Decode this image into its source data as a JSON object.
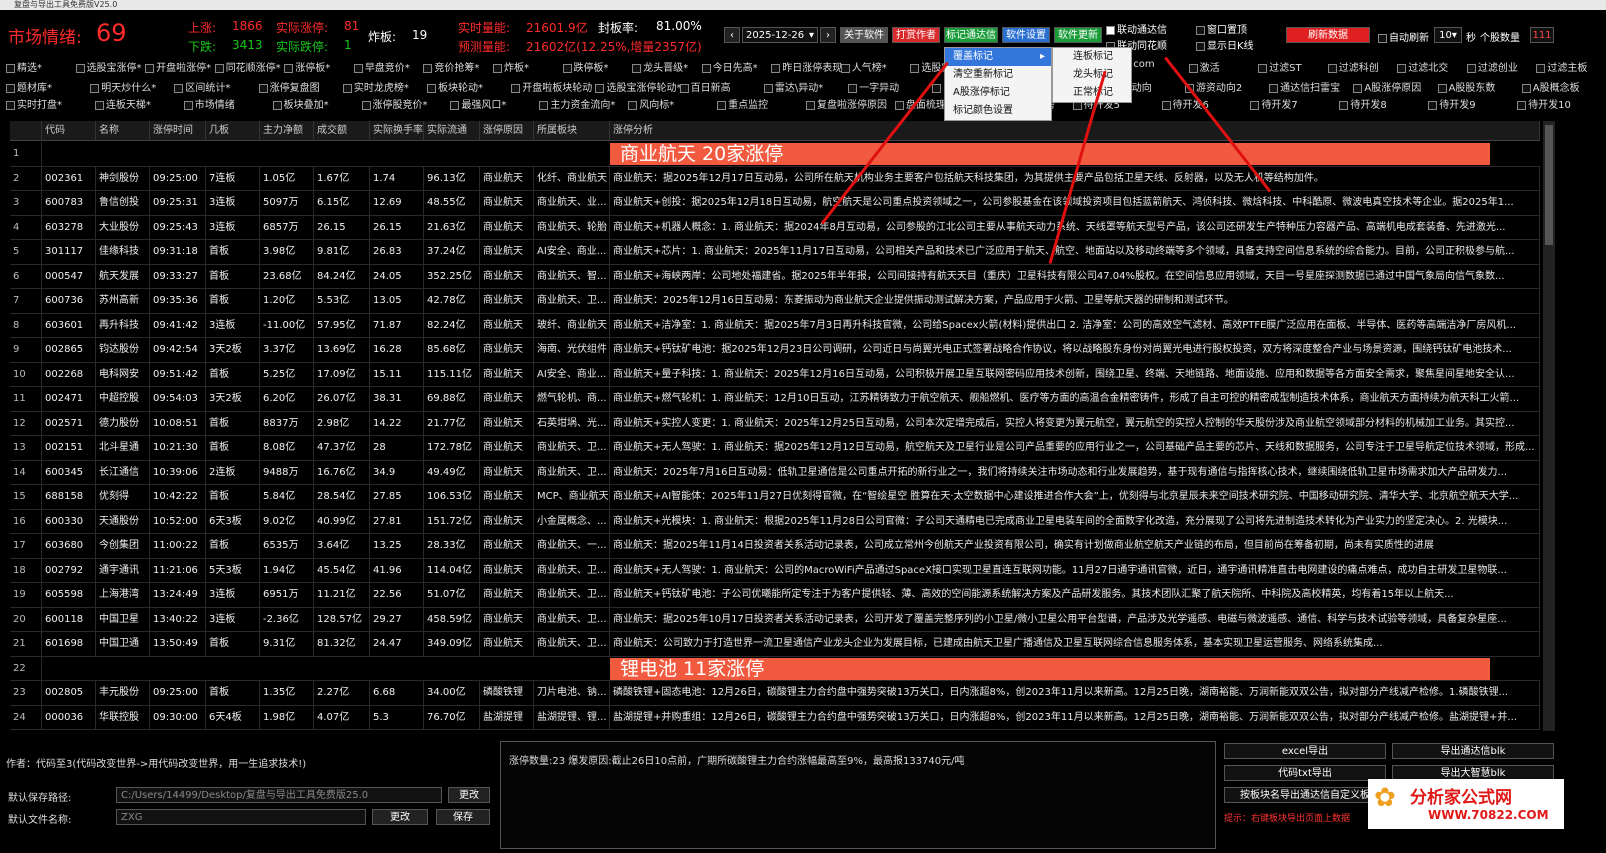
{
  "window": {
    "title": "复盘与导出工具免费版V25.0"
  },
  "header": {
    "sentiment_label": "市场情绪:",
    "sentiment_value": "69",
    "up_label": "上涨:",
    "up_value": "1866",
    "real_limitup_label": "实际涨停:",
    "real_limitup_value": "81",
    "down_label": "下跌:",
    "down_value": "3413",
    "real_limitdown_label": "实际跌停:",
    "real_limitdown_value": "1",
    "broken_label": "炸板:",
    "broken_value": "19",
    "volume_label": "实时量能:",
    "volume_value": "21601.9亿",
    "seal_label": "封板率:",
    "seal_value": "81.00%",
    "forecast_label": "预测量能:",
    "forecast_value": "21602亿(12.25%,增量2357亿)",
    "date": "2025-12-26",
    "buttons": [
      "关于软件",
      "打赏作者",
      "标记通达信",
      "软件设置",
      "软件更新"
    ],
    "link_tdx": "联动通达信",
    "link_ths": "联动同花顺",
    "window_top": "窗口置顶",
    "show_daily": "显示日K线",
    "refresh": "刷新数据",
    "auto_refresh": "自动刷新",
    "seconds": "10",
    "sec_label": "秒",
    "stock_count_label": "个股数量",
    "stock_count": "111"
  },
  "checkrow1": [
    "精选*",
    "选股宝涨停*",
    "开盘啦涨停*",
    "同花顺涨停*",
    "涨停板*",
    "早盘竞价*",
    "竞价抢筹*",
    "炸板*",
    "跌停板*",
    "龙头晋级*",
    "今日先高*",
    "昨日涨停表现*",
    "人气榜*",
    "选股宝热点解读*",
    "查找",
    "授权码:",
    ".com",
    "激活",
    "过滤ST",
    "过滤科创",
    "过滤北交",
    "过滤创业",
    "过滤主板"
  ],
  "checkrow2": [
    "题材库*",
    "明天炒什么*",
    "区间统计*",
    "涨停复盘图",
    "实时龙虎榜*",
    "板块轮动*",
    "开盘啦板块轮动",
    "选股宝涨停轮动*",
    "百日新高",
    "雷达\\异动*",
    "一字异动",
    "韭菜公社异动",
    "同花顺...",
    "游资动向",
    "游资动向2",
    "通达信扫雷宝",
    "A股涨停原因",
    "A股股东数",
    "A股概念板"
  ],
  "checkrow3": [
    "实时打盘*",
    "连板天梯*",
    "市场情绪",
    "板块叠加*",
    "涨停股竞价*",
    "最强风口*",
    "主力资金流向*",
    "风向标*",
    "重点监控",
    "复盘啦涨停原因",
    "盘面梳理",
    "同花顺热度榜",
    "待开发5",
    "待开发6",
    "待开发7",
    "待开发8",
    "待开发9",
    "待开发10"
  ],
  "menu_main": [
    "覆盖标记",
    "清空重新标记",
    "A股涨停标记",
    "标记颜色设置"
  ],
  "menu_sub": [
    "连板标记",
    "龙头标记",
    "正常标记"
  ],
  "columns": [
    "代码",
    "名称",
    "涨停时间",
    "几板",
    "主力净额",
    "成交额",
    "实际换手率",
    "实际流通",
    "涨停原因",
    "所属板块",
    "涨停分析"
  ],
  "rows": [
    {
      "banner": "商业航天    20家涨停",
      "idx": "1"
    },
    {
      "idx": "2",
      "code": "002361",
      "name": "神剑股份",
      "time": "09:25:00",
      "board": "7连板",
      "net": "1.05亿",
      "amt": "1.67亿",
      "turn": "1.74",
      "float": "96.13亿",
      "reason": "商业航天",
      "sector": "化纤、商业航天",
      "analysis": "商业航天：据2025年12月17日互动易，公司所在航天机构业务主要客户包括航天科技集团，为其提供主要产品包括卫星天线、反射器，以及无人机等结构加件。"
    },
    {
      "idx": "3",
      "code": "600783",
      "name": "鲁信创投",
      "time": "09:25:31",
      "board": "3连板",
      "net": "5097万",
      "amt": "6.15亿",
      "turn": "12.69",
      "float": "48.55亿",
      "reason": "商业航天",
      "sector": "商业航天、业...",
      "analysis": "商业航天+创投：据2025年12月18日互动易，航空航天是公司重点投资领域之一，公司参股基金在该领域投资项目包括蓝箭航天、鸿侦科技、微焓科技、中科酷原、微波电真空技术等企业。据2025年1..."
    },
    {
      "idx": "4",
      "code": "603278",
      "name": "大业股份",
      "time": "09:25:43",
      "board": "3连板",
      "net": "6857万",
      "amt": "26.15",
      "turn": "26.15",
      "float": "21.63亿",
      "reason": "商业航天",
      "sector": "商业航天、轮胎",
      "analysis": "商业航天+机器人概念：1. 商业航天：据2024年8月互动易，公司参股的江北公司主要从事航天动力系统、天线罩等航天型号产品，该公司还研发生产特种压力容器产品、高端机电成套装备、先进激光..."
    },
    {
      "idx": "5",
      "code": "301117",
      "name": "佳缘科技",
      "time": "09:31:18",
      "board": "首板",
      "net": "3.98亿",
      "amt": "9.81亿",
      "turn": "26.83",
      "float": "37.24亿",
      "reason": "商业航天",
      "sector": "AI安全、商业...",
      "analysis": "商业航天+芯片：1. 商业航天：2025年11月17日互动易，公司相关产品和技术已广泛应用于航天、航空、地面站以及移动终端等多个领域，具备支持空间信息系统的综合能力。目前，公司正积极参与航..."
    },
    {
      "idx": "6",
      "code": "000547",
      "name": "航天发展",
      "time": "09:33:27",
      "board": "首板",
      "net": "23.68亿",
      "amt": "84.24亿",
      "turn": "24.05",
      "float": "352.25亿",
      "reason": "商业航天",
      "sector": "商业航天、智...",
      "analysis": "商业航天+海峡两岸：公司地处福建省。据2025年半年报，公司间接持有航天天目（重庆）卫星科技有限公司47.04%股权。在空间信息应用领域，天目一号星座探测数据已通过中国气象局向信气象数..."
    },
    {
      "idx": "7",
      "code": "600736",
      "name": "苏州高新",
      "time": "09:35:36",
      "board": "首板",
      "net": "1.20亿",
      "amt": "5.53亿",
      "turn": "13.05",
      "float": "42.78亿",
      "reason": "商业航天",
      "sector": "商业航天、卫...",
      "analysis": "商业航天：2025年12月16日互动易：东菱振动为商业航天企业提供振动测试解决方案，产品应用于火箭、卫星等航天器的研制和测试环节。"
    },
    {
      "idx": "8",
      "code": "603601",
      "name": "再升科技",
      "time": "09:41:42",
      "board": "3连板",
      "net": "-11.00亿",
      "amt": "57.95亿",
      "turn": "71.87",
      "float": "82.24亿",
      "reason": "商业航天",
      "sector": "玻纤、商业航天",
      "analysis": "商业航天+洁净室：1. 商业航天：据2025年7月3日再升科技官微，公司给Spacex火箭(材料)提供出口 2. 洁净室：公司的高效空气滤材、高效PTFE膜广泛应用在面板、半导体、医药等高端洁净厂房风机..."
    },
    {
      "idx": "9",
      "code": "002865",
      "name": "钧达股份",
      "time": "09:42:54",
      "board": "3天2板",
      "net": "3.37亿",
      "amt": "13.69亿",
      "turn": "16.28",
      "float": "85.68亿",
      "reason": "商业航天",
      "sector": "海南、光伏组件",
      "analysis": "商业航天+钙钛矿电池：据2025年12月23日公司调研，公司近日与尚翼光电正式签署战略合作协议，将以战略股东身份对尚翼光电进行股权投资，双方将深度整合产业与场景资源，围绕钙钛矿电池技术..."
    },
    {
      "idx": "10",
      "code": "002268",
      "name": "电科网安",
      "time": "09:51:42",
      "board": "首板",
      "net": "5.25亿",
      "amt": "17.09亿",
      "turn": "15.11",
      "float": "115.11亿",
      "reason": "商业航天",
      "sector": "AI安全、商业...",
      "analysis": "商业航天+量子科技：1. 商业航天：2025年12月16日互动易，公司积极开展卫星互联网密码应用技术创新，围绕卫星、终端、天地链路、地面设施、应用和数据等各方面安全需求，聚焦星间星地安全认..."
    },
    {
      "idx": "11",
      "code": "002471",
      "name": "中超控股",
      "time": "09:54:03",
      "board": "3天2板",
      "net": "6.20亿",
      "amt": "26.07亿",
      "turn": "38.31",
      "float": "69.88亿",
      "reason": "商业航天",
      "sector": "燃气轮机、商...",
      "analysis": "商业航天+燃气轮机：1. 商业航天：12月10日互动，江苏精铸致力于航空航天、舰船燃机、医疗等方面的高温合金精密铸件，形成了自主可控的精密成型制造技术体系，商业航天方面持续为航天科工火箭..."
    },
    {
      "idx": "12",
      "code": "002571",
      "name": "德力股份",
      "time": "10:08:51",
      "board": "首板",
      "net": "8837万",
      "amt": "2.98亿",
      "turn": "14.22",
      "float": "21.77亿",
      "reason": "商业航天",
      "sector": "石英坩埚、光...",
      "analysis": "商业航天+实控人变更：1. 商业航天：2025年12月25日互动易，公司本次定增完成后，实控人将变更为翼元航空，翼元航空的实控人控制的华天股份涉及商业航空领域部分材料的机械加工业务。其实控..."
    },
    {
      "idx": "13",
      "code": "002151",
      "name": "北斗星通",
      "time": "10:21:30",
      "board": "首板",
      "net": "8.08亿",
      "amt": "47.37亿",
      "turn": "28",
      "float": "172.78亿",
      "reason": "商业航天",
      "sector": "商业航天、卫...",
      "analysis": "商业航天+无人驾驶：1. 商业航天：据2025年12月12日互动易，航空航天及卫星行业是公司产品重要的应用行业之一，公司基础产品主要的芯片、天线和数据服务，公司专注于卫星导航定位技术领域，形成..."
    },
    {
      "idx": "14",
      "code": "600345",
      "name": "长江通信",
      "time": "10:39:06",
      "board": "2连板",
      "net": "9488万",
      "amt": "16.76亿",
      "turn": "34.9",
      "float": "49.49亿",
      "reason": "商业航天",
      "sector": "商业航天、卫...",
      "analysis": "商业航天：2025年7月16日互动易：低轨卫星通信是公司重点开拓的新行业之一，我们将持续关注市场动态和行业发展趋势，基于现有通信与指挥核心技术，继续围绕低轨卫星市场需求加大产品研发力..."
    },
    {
      "idx": "15",
      "code": "688158",
      "name": "优刻得",
      "time": "10:42:22",
      "board": "首板",
      "net": "5.84亿",
      "amt": "28.54亿",
      "turn": "27.85",
      "float": "106.53亿",
      "reason": "商业航天",
      "sector": "MCP、商业航天",
      "analysis": "商业航天+AI智能体：2025年11月27日优刻得官微，在“智绘星空 胜算在天·太空数据中心建设推进合作大会”上，优刻得与北京星辰未来空间技术研究院、中国移动研究院、清华大学、北京航空航天大学..."
    },
    {
      "idx": "16",
      "code": "600330",
      "name": "天通股份",
      "time": "10:52:00",
      "board": "6天3板",
      "net": "9.02亿",
      "amt": "40.99亿",
      "turn": "27.81",
      "float": "151.72亿",
      "reason": "商业航天",
      "sector": "小金属概念、...",
      "analysis": "商业航天+光模块：1. 商业航天：根据2025年11月28日公司官微：子公司天通精电已完成商业卫星电装车间的全面数字化改造，充分展现了公司将先进制造技术转化为产业实力的坚定决心。2. 光模块..."
    },
    {
      "idx": "17",
      "code": "603680",
      "name": "今创集团",
      "time": "11:00:22",
      "board": "首板",
      "net": "6535万",
      "amt": "3.64亿",
      "turn": "13.25",
      "float": "28.33亿",
      "reason": "商业航天",
      "sector": "商业航天、一...",
      "analysis": "商业航天：据2025年11月14日投资者关系活动记录表，公司成立常州今创航天产业投资有限公司，确实有计划做商业航空航天产业链的布局，但目前尚在筹备初期，尚未有实质性的进展"
    },
    {
      "idx": "18",
      "code": "002792",
      "name": "通宇通讯",
      "time": "11:21:06",
      "board": "5天3板",
      "net": "1.94亿",
      "amt": "45.54亿",
      "turn": "41.96",
      "float": "114.04亿",
      "reason": "商业航天",
      "sector": "商业航天、卫...",
      "analysis": "商业航天+无人驾驶：1. 商业航天：公司的MacroWiFi产品通过SpaceX接口实现卫星直连互联网功能。11月27日通宇通讯官微，近日，通宇通讯精准直击电网建设的痛点难点，成功自主研发卫星物联..."
    },
    {
      "idx": "19",
      "code": "605598",
      "name": "上海港湾",
      "time": "13:24:49",
      "board": "3连板",
      "net": "6951万",
      "amt": "11.21亿",
      "turn": "22.56",
      "float": "51.07亿",
      "reason": "商业航天",
      "sector": "商业航天、卫...",
      "analysis": "商业航天+钙钛矿电池：子公司优曦能所定专注于为客户提供轻、薄、高效的空间能源系统解决方案及产品研发服务。其技术团队汇聚了航天院所、中科院及高校精英，均有着15年以上航天..."
    },
    {
      "idx": "20",
      "code": "600118",
      "name": "中国卫星",
      "time": "13:40:22",
      "board": "3连板",
      "net": "-2.36亿",
      "amt": "128.57亿",
      "turn": "29.27",
      "float": "458.59亿",
      "reason": "商业航天",
      "sector": "商业航天、卫...",
      "analysis": "商业航天：据2025年10月17日投资者关系活动记录表，公司开发了覆盖完整序列的小卫星/微小卫星公用平台型谱，产品涉及光学遥感、电磁与微波遥感、通信、科学与技术试验等领域，具备复杂星座..."
    },
    {
      "idx": "21",
      "code": "601698",
      "name": "中国卫通",
      "time": "13:50:49",
      "board": "首板",
      "net": "9.31亿",
      "amt": "81.32亿",
      "turn": "24.47",
      "float": "349.09亿",
      "reason": "商业航天",
      "sector": "商业航天、卫...",
      "analysis": "商业航天：公司致力于打造世界一流卫星通信产业龙头企业为发展目标，已建成由航天卫星广播通信及卫星互联网综合信息服务体系，基本实现卫星运营服务、网络系统集成..."
    },
    {
      "banner": "锂电池    11家涨停",
      "idx": "22"
    },
    {
      "idx": "23",
      "code": "002805",
      "name": "丰元股份",
      "time": "09:25:00",
      "board": "首板",
      "net": "1.35亿",
      "amt": "2.27亿",
      "turn": "6.68",
      "float": "34.00亿",
      "reason": "磷酸铁锂",
      "sector": "刀片电池、钠...",
      "analysis": "磷酸铁锂+固态电池：12月26日，碳酸锂主力合约盘中强势突破13万关口，日内涨超8%，创2023年11月以来新高。12月25日晚，湖南裕能、万润新能双双公告，拟对部分产线减产检修。1.磷酸铁锂..."
    },
    {
      "idx": "24",
      "code": "000036",
      "name": "华联控股",
      "time": "09:30:00",
      "board": "6天4板",
      "net": "1.98亿",
      "amt": "4.07亿",
      "turn": "5.3",
      "float": "76.70亿",
      "reason": "盐湖提锂",
      "sector": "盐湖提锂、锂...",
      "analysis": "盐湖提锂+并购重组：12月26日，碳酸锂主力合约盘中强势突破13万关口，日内涨超8%，创2023年11月以来新高。12月25日晚，湖南裕能、万润新能双双公告，拟对部分产线减产检修。盐湖提锂+并..."
    }
  ],
  "footer": {
    "author": "作者：代码至3(代码改变世界->用代码改变世界，用一生追求技术!)",
    "save_path_label": "默认保存路径:",
    "save_path": "C:/Users/14499/Desktop/复盘与导出工具免费版25.0",
    "change": "更改",
    "filename_label": "默认文件名称:",
    "filename": "ZXG",
    "change2": "更改",
    "save": "保存",
    "summary": "涨停数量:23    爆发原因:截止26日10点前，广期所碳酸锂主力合约涨幅最高至9%，最高报133740元/吨",
    "btn_excel": "excel导出",
    "btn_tdx_blk": "导出通达信blk",
    "btn_code_txt": "代码txt导出",
    "btn_dzh_blk": "导出大智慧blk",
    "btn_sector_export": "按板块名导出通达信自定义板",
    "hint": "提示：右键板块导出页面上数据",
    "logo": "分析家公式网",
    "logo_url": "WWW.70822.COM"
  }
}
